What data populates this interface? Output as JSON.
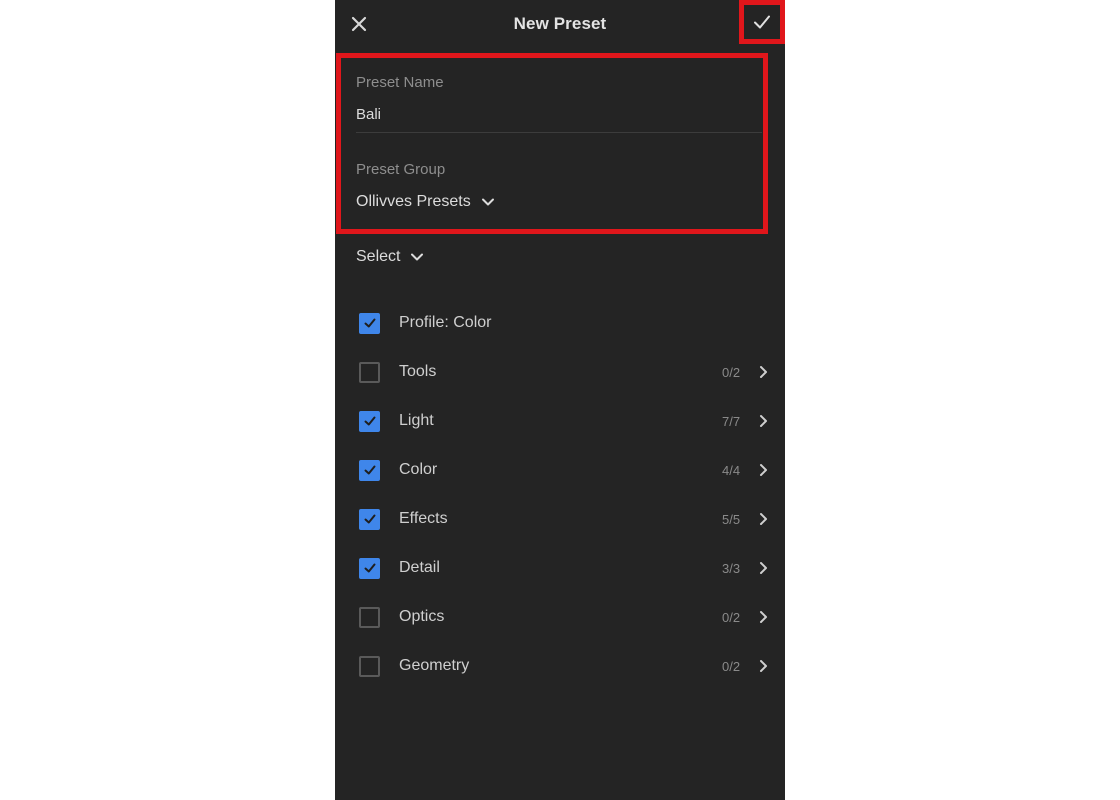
{
  "header": {
    "title": "New Preset",
    "close_icon": "close-icon",
    "confirm_icon": "checkmark-icon"
  },
  "form": {
    "preset_name_label": "Preset Name",
    "preset_name_value": "Bali",
    "preset_group_label": "Preset Group",
    "preset_group_value": "Ollivves Presets"
  },
  "select": {
    "label": "Select"
  },
  "settings": [
    {
      "label": "Profile: Color",
      "checked": true,
      "count": "",
      "has_arrow": false
    },
    {
      "label": "Tools",
      "checked": false,
      "count": "0/2",
      "has_arrow": true
    },
    {
      "label": "Light",
      "checked": true,
      "count": "7/7",
      "has_arrow": true
    },
    {
      "label": "Color",
      "checked": true,
      "count": "4/4",
      "has_arrow": true
    },
    {
      "label": "Effects",
      "checked": true,
      "count": "5/5",
      "has_arrow": true
    },
    {
      "label": "Detail",
      "checked": true,
      "count": "3/3",
      "has_arrow": true
    },
    {
      "label": "Optics",
      "checked": false,
      "count": "0/2",
      "has_arrow": true
    },
    {
      "label": "Geometry",
      "checked": false,
      "count": "0/2",
      "has_arrow": true
    }
  ],
  "colors": {
    "background": "#242424",
    "accent": "#3f86ea",
    "highlight": "#e0161b"
  }
}
